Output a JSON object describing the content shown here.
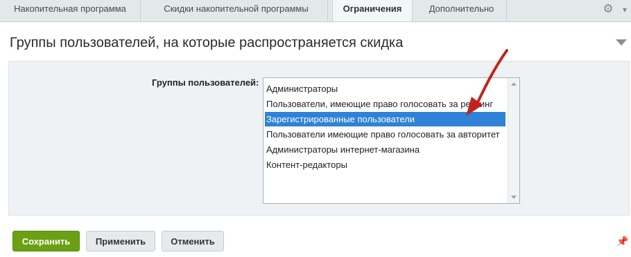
{
  "tabs": [
    {
      "label": "Накопительная программа"
    },
    {
      "label": "Скидки накопительной программы"
    },
    {
      "label": "Ограничения"
    },
    {
      "label": "Дополнительно"
    }
  ],
  "active_tab": "Ограничения",
  "section": {
    "title": "Группы пользователей, на которые распространяется скидка"
  },
  "form": {
    "field_label": "Группы пользователей:",
    "options": [
      {
        "label": "Администраторы"
      },
      {
        "label": "Пользователи, имеющие право голосовать за рейтинг"
      },
      {
        "label": "Зарегистрированные пользователи"
      },
      {
        "label": "Пользователи имеющие право голосовать за авторитет"
      },
      {
        "label": "Администраторы интернет-магазина"
      },
      {
        "label": "Контент-редакторы"
      }
    ],
    "selected": "Зарегистрированные пользователи"
  },
  "buttons": {
    "save": "Сохранить",
    "apply": "Применить",
    "cancel": "Отменить"
  },
  "icons": {
    "settings": "gear-icon",
    "tabs_menu": "chevron-down-icon",
    "collapse": "triangle-down-icon",
    "pin": "pin-icon",
    "annotation": "red-arrow"
  },
  "colors": {
    "accent_selection": "#2f82d8",
    "save_button": "#6aa014",
    "annotation_arrow": "#c0231b"
  }
}
